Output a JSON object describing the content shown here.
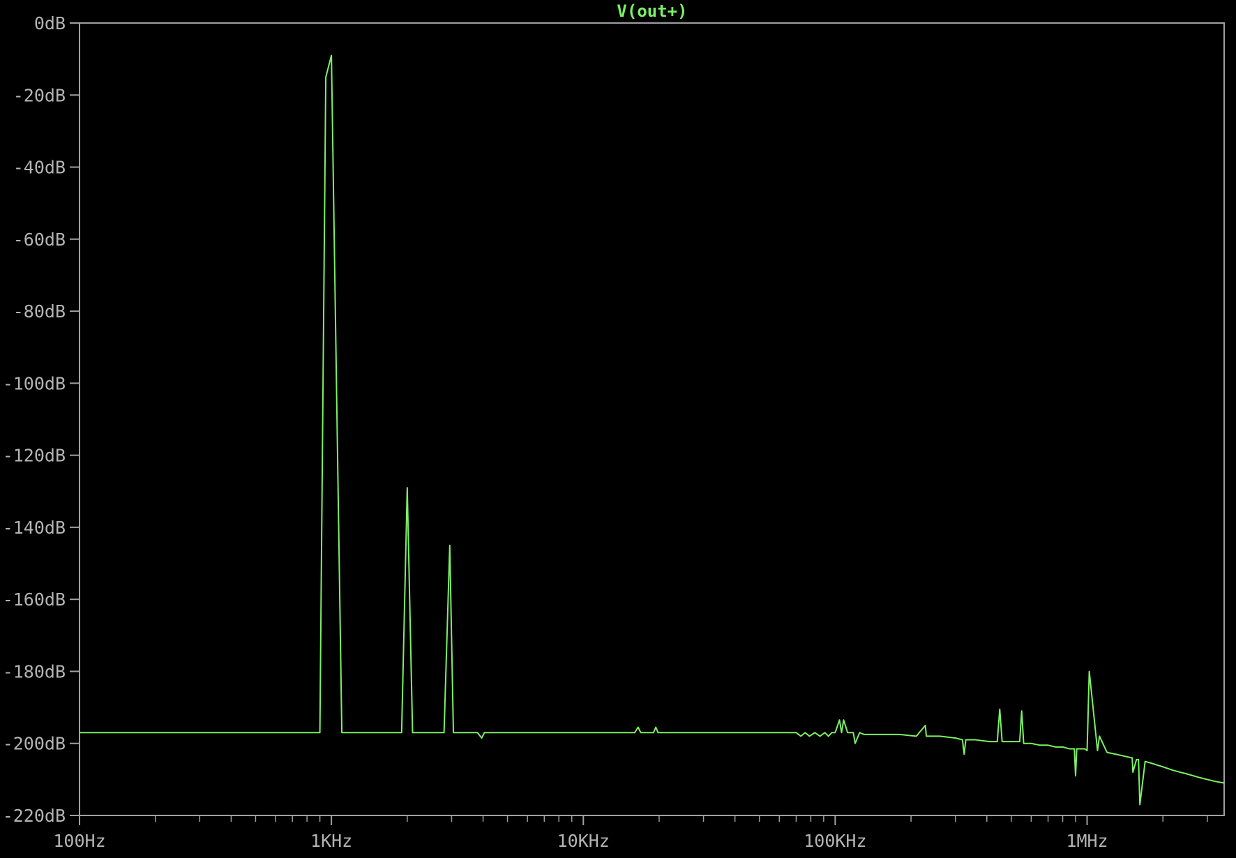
{
  "chart_data": {
    "type": "line",
    "title": "V(out+)",
    "xlabel": "",
    "ylabel": "",
    "x_scale": "log",
    "xlim": [
      100,
      3500000
    ],
    "ylim": [
      -220,
      0
    ],
    "grid": false,
    "x_ticks": [
      {
        "value": 100,
        "label": "100Hz"
      },
      {
        "value": 1000,
        "label": "1KHz"
      },
      {
        "value": 10000,
        "label": "10KHz"
      },
      {
        "value": 100000,
        "label": "100KHz"
      },
      {
        "value": 1000000,
        "label": "1MHz"
      }
    ],
    "y_ticks": [
      {
        "value": 0,
        "label": "0dB"
      },
      {
        "value": -20,
        "label": "-20dB"
      },
      {
        "value": -40,
        "label": "-40dB"
      },
      {
        "value": -60,
        "label": "-60dB"
      },
      {
        "value": -80,
        "label": "-80dB"
      },
      {
        "value": -100,
        "label": "-100dB"
      },
      {
        "value": -120,
        "label": "-120dB"
      },
      {
        "value": -140,
        "label": "-140dB"
      },
      {
        "value": -160,
        "label": "-160dB"
      },
      {
        "value": -180,
        "label": "-180dB"
      },
      {
        "value": -200,
        "label": "-200dB"
      },
      {
        "value": -220,
        "label": "-220dB"
      }
    ],
    "colors": {
      "background": "#000000",
      "axis": "#a0a0a0",
      "tick_label": "#b4b4b4",
      "trace": "#7cf064"
    },
    "series": [
      {
        "name": "V(out+)",
        "color": "#7cf064",
        "x": [
          100,
          500,
          900,
          950,
          1000,
          1100,
          1500,
          1900,
          2000,
          2100,
          2800,
          2950,
          3050,
          3800,
          3950,
          4050,
          10000,
          16000,
          16500,
          16900,
          19000,
          19400,
          19800,
          30000,
          50000,
          70000,
          73000,
          76000,
          79000,
          83000,
          87000,
          91000,
          94000,
          97000,
          100000,
          104000,
          106000,
          108000,
          112000,
          118000,
          120000,
          125000,
          130000,
          150000,
          180000,
          210000,
          228000,
          230000,
          232000,
          260000,
          300000,
          320000,
          325000,
          330000,
          360000,
          410000,
          440000,
          450000,
          460000,
          500000,
          540000,
          550000,
          560000,
          600000,
          650000,
          700000,
          750000,
          800000,
          850000,
          890000,
          900000,
          910000,
          980000,
          1000000,
          1020000,
          1100000,
          1120000,
          1200000,
          1300000,
          1400000,
          1500000,
          1510000,
          1520000,
          1570000,
          1600000,
          1620000,
          1700000,
          1800000,
          2000000,
          2200000,
          2500000,
          2800000,
          3200000,
          3500000
        ],
        "y": [
          -197,
          -197,
          -197,
          -15,
          -9,
          -197,
          -197,
          -197,
          -129,
          -197,
          -197,
          -145,
          -197,
          -197,
          -198.5,
          -197,
          -197,
          -197,
          -195.5,
          -197,
          -197,
          -195.5,
          -197,
          -197,
          -197,
          -197,
          -198,
          -197,
          -198,
          -197,
          -198,
          -197,
          -198,
          -197,
          -197,
          -193.5,
          -197,
          -193.5,
          -197,
          -197,
          -200,
          -197,
          -197.5,
          -197.5,
          -197.5,
          -198,
          -195,
          -198,
          -198,
          -198,
          -198.5,
          -199,
          -203,
          -199,
          -199,
          -199.5,
          -199.5,
          -190.5,
          -199.5,
          -199.5,
          -199.5,
          -191,
          -200,
          -200,
          -200.5,
          -200.5,
          -201,
          -201,
          -201.5,
          -201.5,
          -209,
          -201.5,
          -201.5,
          -202,
          -180,
          -202,
          -198,
          -202.5,
          -203,
          -203.5,
          -204,
          -204,
          -208,
          -204.5,
          -204.5,
          -217,
          -205,
          -205.5,
          -206.5,
          -207.5,
          -208.5,
          -209.5,
          -210.5,
          -211
        ]
      }
    ]
  }
}
